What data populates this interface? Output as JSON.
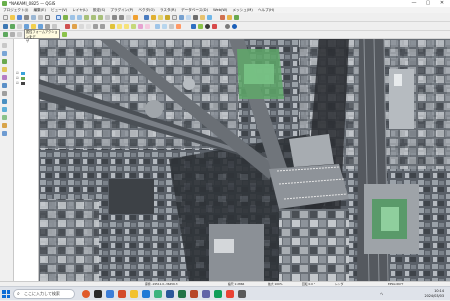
{
  "app": {
    "title": "*NAKAMI_0825 — QGIS"
  },
  "window_controls": {
    "minimize": "—",
    "maximize": "▢",
    "close": "✕"
  },
  "menu": [
    "プロジェクト(J)",
    "編集(E)",
    "ビュー(V)",
    "レイヤ(L)",
    "設定(S)",
    "プラグイン(P)",
    "ベクタ(O)",
    "ラスタ(R)",
    "データベース(D)",
    "Web(W)",
    "メッシュ(M)",
    "ヘルプ(H)"
  ],
  "tooltip": {
    "line1": "属性フォームアクションをデ",
    "line2": "ザ"
  },
  "layers": [
    {
      "label": "☑"
    },
    {
      "label": "☑"
    },
    {
      "label": "☑"
    }
  ],
  "statusbar": {
    "coordinate": "座標 -19511.0,-36456.3",
    "scale": "縮尺 1:2866",
    "magnifier": "拡大 100%",
    "rotation": "回転 0.0 °",
    "render": "レンダ",
    "crs": "EPSG:6677"
  },
  "taskbar": {
    "search_placeholder": "ここに入力して検索",
    "tray_temp": "へ",
    "time": "10:14",
    "date": "2024/03/03"
  },
  "colors": {
    "accent": "#0a6cd6",
    "qgis_green": "#6ab04c"
  }
}
